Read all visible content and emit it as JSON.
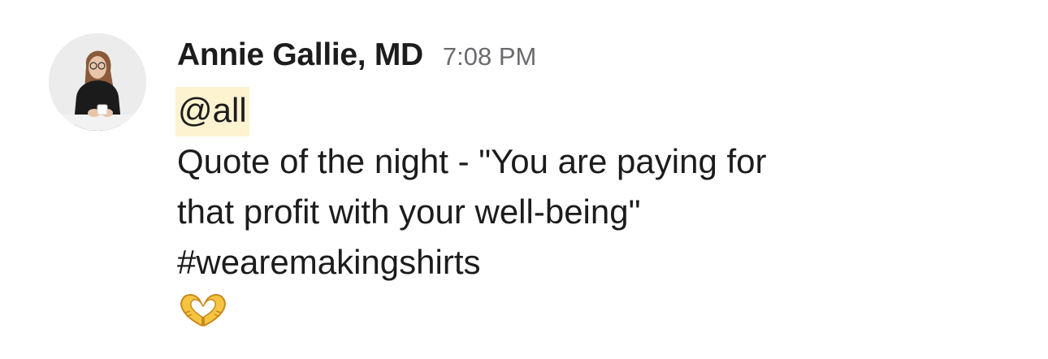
{
  "message": {
    "author": "Annie Gallie, MD",
    "timestamp": "7:08 PM",
    "mention": "@all",
    "lines": [
      "Quote of the night - \"You are paying for",
      "that profit with your well-being\"",
      "#wearemakingshirts"
    ],
    "reaction_emoji": "heart-hands-emoji"
  }
}
